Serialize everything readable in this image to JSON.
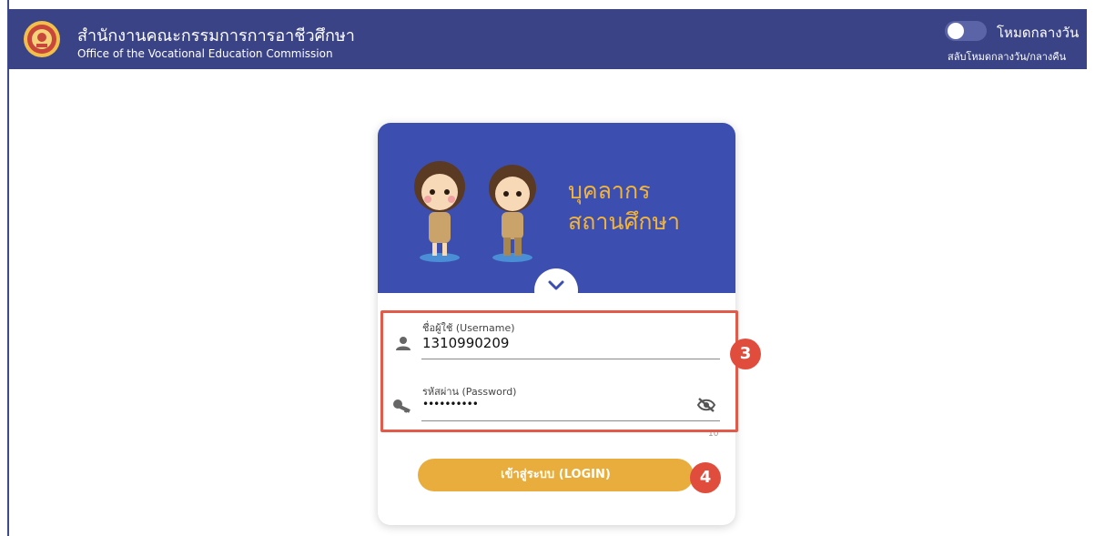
{
  "header": {
    "org_name_th": "สำนักงานคณะกรรมการการอาชีวศึกษา",
    "org_name_en": "Office of the Vocational Education Commission",
    "mode_label": "โหมดกลางวัน",
    "mode_sub": "สลับโหมดกลางวัน/กลางคืน",
    "dark_mode_on": false
  },
  "card": {
    "title_line1": "บุคลากร",
    "title_line2": "สถานศึกษา"
  },
  "form": {
    "username_label": "ชื่อผู้ใช้ (Username)",
    "username_value": "1310990209",
    "password_label": "รหัสผ่าน (Password)",
    "password_value": "••••••••••",
    "password_counter": "10",
    "login_label": "เข้าสู่ระบบ (LOGIN)"
  },
  "annotations": {
    "step_fields": "3",
    "step_login": "4"
  },
  "colors": {
    "topbar": "#3a4385",
    "banner": "#3c4fb0",
    "accent": "#e8ad3d",
    "marker": "#e14d3d"
  }
}
